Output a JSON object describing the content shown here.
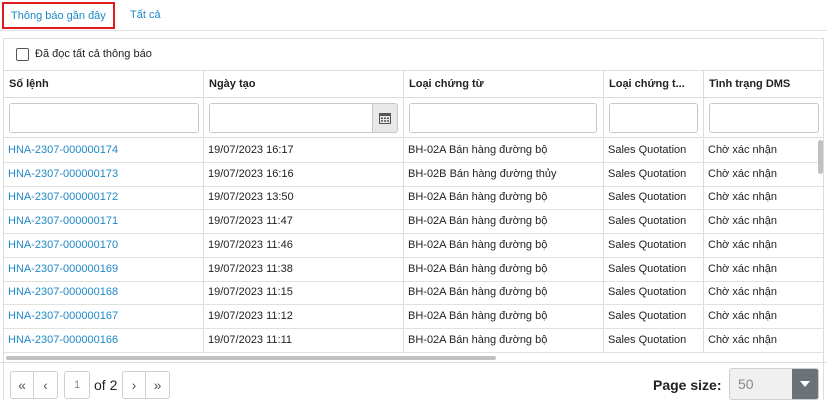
{
  "tabs": [
    {
      "label": "Thông báo gần đây",
      "active": true
    },
    {
      "label": "Tất cả",
      "active": false
    }
  ],
  "read_all_label": "Đã đọc tất cả thông báo",
  "columns": [
    "Số lệnh",
    "Ngày tạo",
    "Loại chứng từ",
    "Loại chứng t...",
    "Tình trạng DMS"
  ],
  "rows": [
    {
      "id": "HNA-2307-000000174",
      "date": "19/07/2023 16:17",
      "doc_type": "BH-02A Bán hàng đường bộ",
      "category": "Sales Quotation",
      "status": "Chờ xác nhận"
    },
    {
      "id": "HNA-2307-000000173",
      "date": "19/07/2023 16:16",
      "doc_type": "BH-02B Bán hàng đường thủy",
      "category": "Sales Quotation",
      "status": "Chờ xác nhận"
    },
    {
      "id": "HNA-2307-000000172",
      "date": "19/07/2023 13:50",
      "doc_type": "BH-02A Bán hàng đường bộ",
      "category": "Sales Quotation",
      "status": "Chờ xác nhận"
    },
    {
      "id": "HNA-2307-000000171",
      "date": "19/07/2023 11:47",
      "doc_type": "BH-02A Bán hàng đường bộ",
      "category": "Sales Quotation",
      "status": "Chờ xác nhận"
    },
    {
      "id": "HNA-2307-000000170",
      "date": "19/07/2023 11:46",
      "doc_type": "BH-02A Bán hàng đường bộ",
      "category": "Sales Quotation",
      "status": "Chờ xác nhận"
    },
    {
      "id": "HNA-2307-000000169",
      "date": "19/07/2023 11:38",
      "doc_type": "BH-02A Bán hàng đường bộ",
      "category": "Sales Quotation",
      "status": "Chờ xác nhận"
    },
    {
      "id": "HNA-2307-000000168",
      "date": "19/07/2023 11:15",
      "doc_type": "BH-02A Bán hàng đường bộ",
      "category": "Sales Quotation",
      "status": "Chờ xác nhận"
    },
    {
      "id": "HNA-2307-000000167",
      "date": "19/07/2023 11:12",
      "doc_type": "BH-02A Bán hàng đường bộ",
      "category": "Sales Quotation",
      "status": "Chờ xác nhận"
    },
    {
      "id": "HNA-2307-000000166",
      "date": "19/07/2023 11:11",
      "doc_type": "BH-02A Bán hàng đường bộ",
      "category": "Sales Quotation",
      "status": "Chờ xác nhận"
    }
  ],
  "pager": {
    "current_page": "1",
    "of_pages": "of 2",
    "page_size_label": "Page size:",
    "page_size": "50"
  },
  "colors": {
    "link": "#1e88c8",
    "active_tab_border": "#e01b1b"
  }
}
